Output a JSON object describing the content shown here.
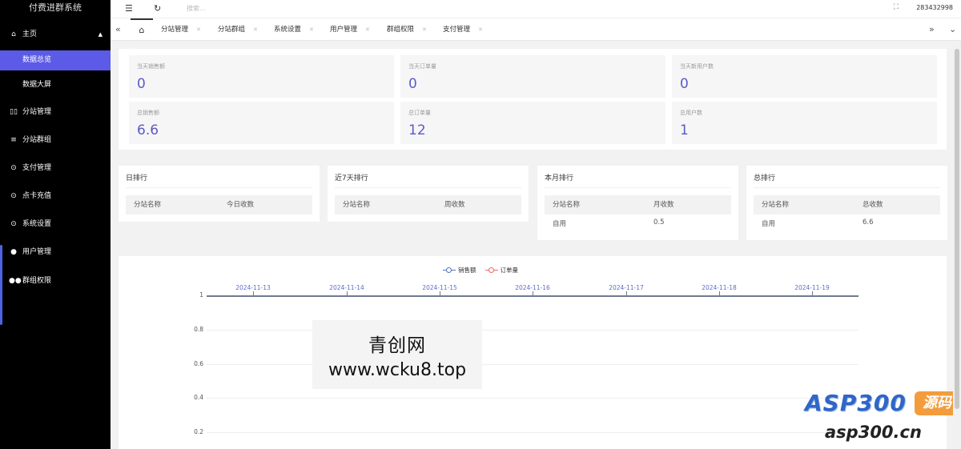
{
  "app": {
    "title": "付费进群系统"
  },
  "sidebar": {
    "items": [
      {
        "label": "主页",
        "icon": "home-icon"
      },
      {
        "label": "分站管理",
        "icon": "columns-icon"
      },
      {
        "label": "分站群组",
        "icon": "sliders-icon"
      },
      {
        "label": "支付管理",
        "icon": "shield-check-icon"
      },
      {
        "label": "点卡充值",
        "icon": "shield-check-icon"
      },
      {
        "label": "系统设置",
        "icon": "shield-check-icon"
      },
      {
        "label": "用户管理",
        "icon": "user-icon"
      },
      {
        "label": "群组权限",
        "icon": "users-icon"
      }
    ],
    "subitems": [
      {
        "label": "数据总览",
        "active": true
      },
      {
        "label": "数据大屏",
        "active": false
      }
    ],
    "active_color": "#5b5be8"
  },
  "topbar": {
    "search_placeholder": "搜索...",
    "user": "283432998"
  },
  "tabs": [
    {
      "label": "分站管理"
    },
    {
      "label": "分站群组"
    },
    {
      "label": "系统设置"
    },
    {
      "label": "用户管理"
    },
    {
      "label": "群组权限"
    },
    {
      "label": "支付管理"
    }
  ],
  "stats": [
    {
      "label": "当天销售额",
      "value": "0"
    },
    {
      "label": "当天订单量",
      "value": "0"
    },
    {
      "label": "当天新用户数",
      "value": "0"
    },
    {
      "label": "总销售额",
      "value": "6.6"
    },
    {
      "label": "总订单量",
      "value": "12"
    },
    {
      "label": "总用户数",
      "value": "1"
    }
  ],
  "rankings": [
    {
      "title": "日排行",
      "col1": "分站名称",
      "col2": "今日收数",
      "rows": []
    },
    {
      "title": "近7天排行",
      "col1": "分站名称",
      "col2": "周收数",
      "rows": []
    },
    {
      "title": "本月排行",
      "col1": "分站名称",
      "col2": "月收数",
      "rows": [
        {
          "name": "自用",
          "value": "0.5"
        }
      ]
    },
    {
      "title": "总排行",
      "col1": "分站名称",
      "col2": "总收数",
      "rows": [
        {
          "name": "自用",
          "value": "6.6"
        }
      ]
    }
  ],
  "chart_data": {
    "type": "line",
    "x": [
      "2024-11-13",
      "2024-11-14",
      "2024-11-15",
      "2024-11-16",
      "2024-11-17",
      "2024-11-18",
      "2024-11-19"
    ],
    "y_ticks": [
      "1",
      "0.8",
      "0.6",
      "0.4",
      "0.2"
    ],
    "series": [
      {
        "name": "销售额",
        "color": "#5470c6"
      },
      {
        "name": "订单量",
        "color": "#ee6666"
      }
    ],
    "x_axis_position": "top",
    "grid": true,
    "legend": "top-center"
  },
  "watermark": {
    "line1": "青创网",
    "line2": "www.wcku8.top",
    "logo_text": "ASP300",
    "logo_badge": "源码",
    "logo_url": "asp300.cn"
  }
}
